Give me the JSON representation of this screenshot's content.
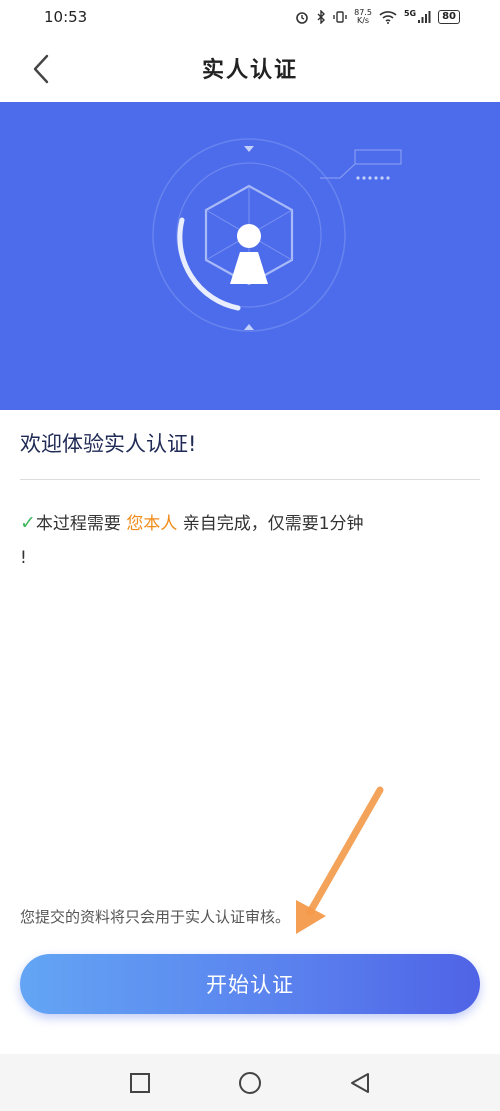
{
  "status_bar": {
    "time": "10:53",
    "net_speed_value": "87.5",
    "net_speed_unit": "K/s",
    "signal_label": "5G",
    "battery": "80"
  },
  "header": {
    "title": "实人认证",
    "back_icon": "chevron-left-icon"
  },
  "banner": {
    "illustration": "face-scan-icon",
    "background_color": "#4d6ceb"
  },
  "content": {
    "welcome": "欢迎体验实人认证!",
    "notice_prefix": "本过程需要",
    "notice_highlight": "您本人",
    "notice_suffix": "亲自完成，仅需要1分钟",
    "notice_tail": "!",
    "privacy_note": "您提交的资料将只会用于实人认证审核。"
  },
  "actions": {
    "start_label": "开始认证"
  },
  "colors": {
    "accent": "#4f63e6",
    "highlight": "#f08c1a",
    "check": "#3fb85e"
  },
  "nav_bar": {
    "icons": [
      "square-icon",
      "circle-icon",
      "triangle-back-icon"
    ]
  }
}
